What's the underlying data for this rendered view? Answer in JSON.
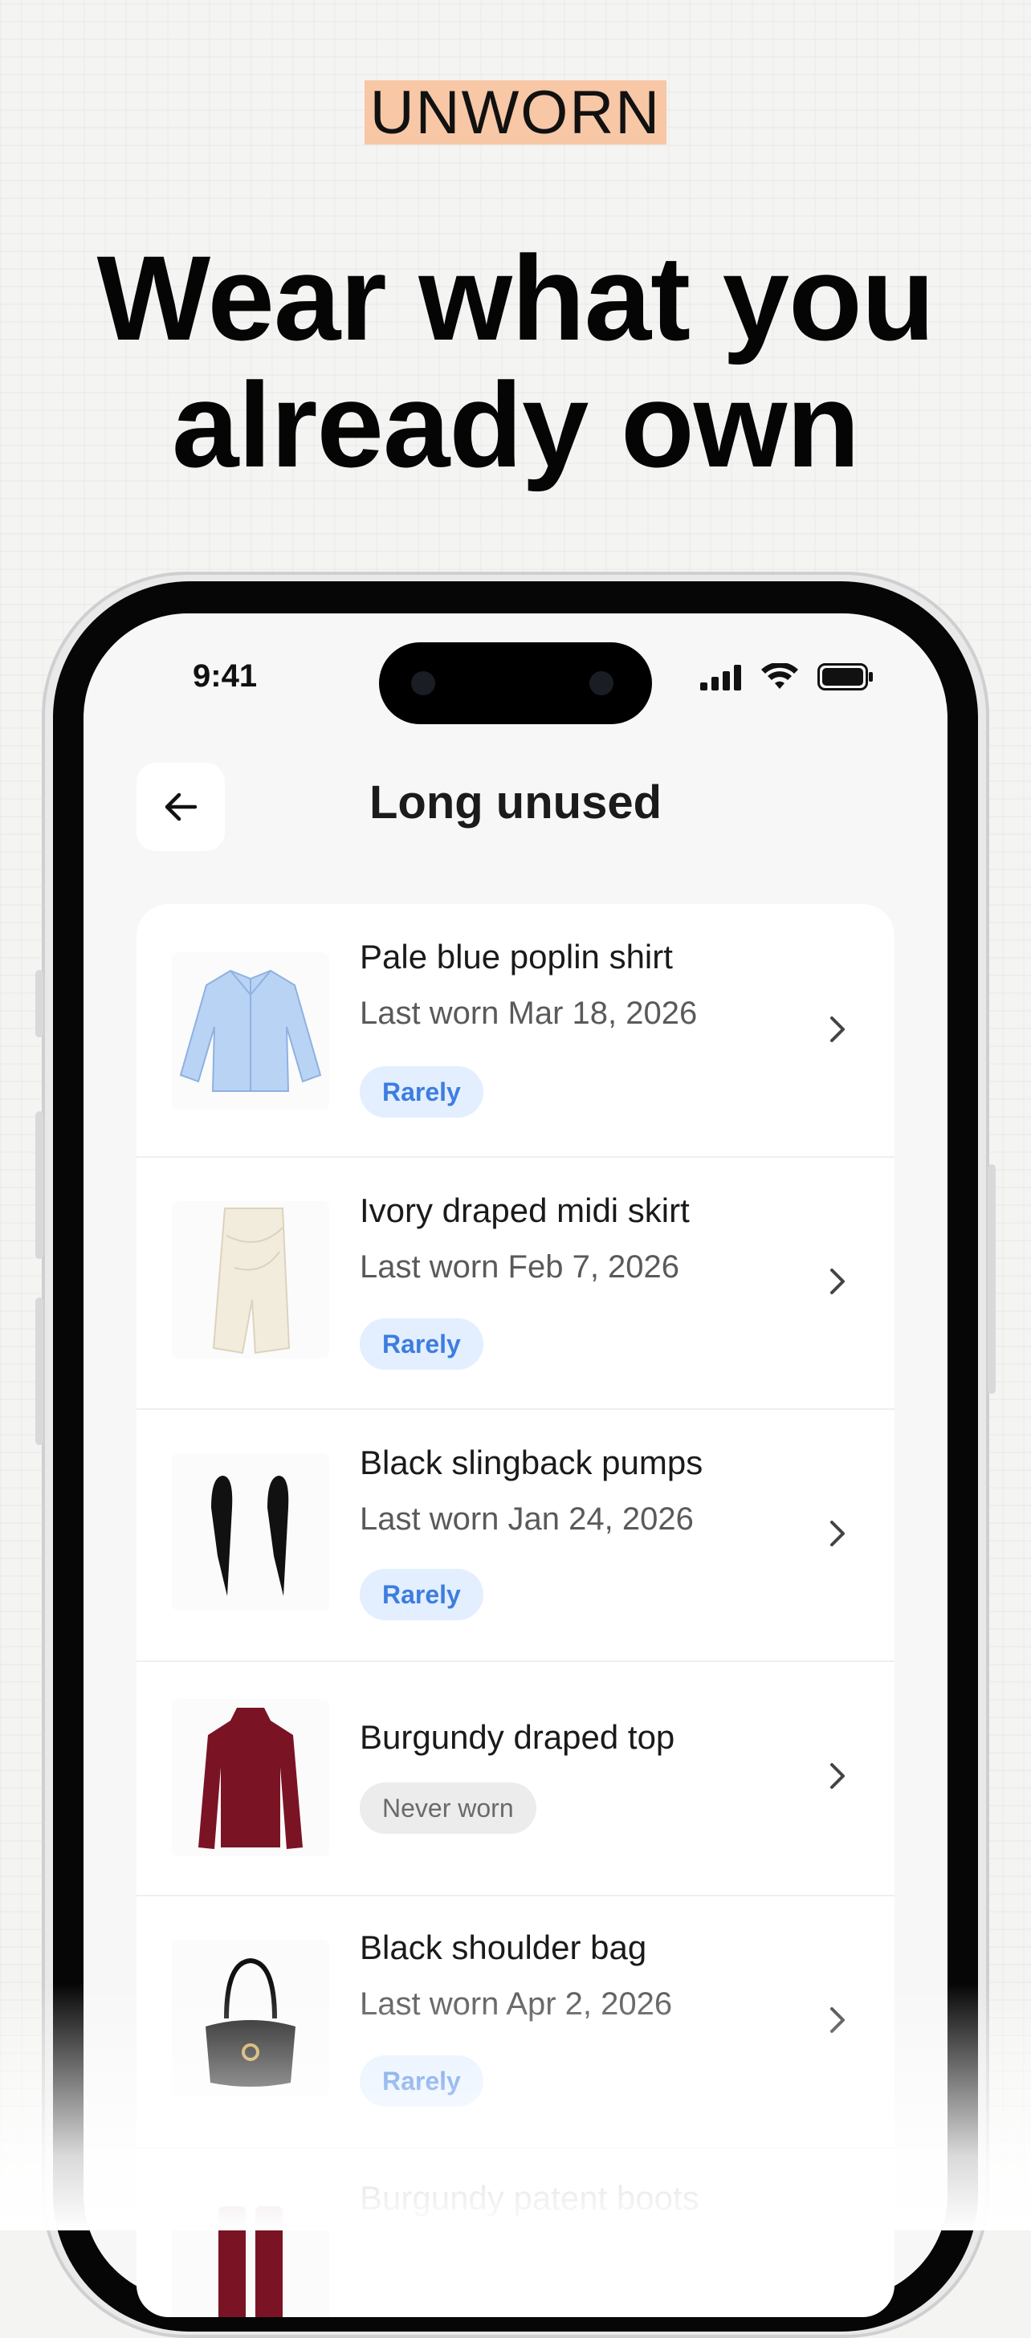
{
  "brand": {
    "tag": "UNWORN"
  },
  "headline": {
    "line1": "Wear what you",
    "line2": "already own"
  },
  "status_bar": {
    "time": "9:41"
  },
  "header": {
    "title": "Long unused"
  },
  "items": [
    {
      "name": "Pale blue poplin shirt",
      "last_worn": "Last worn Mar 18, 2026",
      "badge": "Rarely"
    },
    {
      "name": "Ivory draped midi skirt",
      "last_worn": "Last worn Feb 7, 2026",
      "badge": "Rarely"
    },
    {
      "name": "Black slingback pumps",
      "last_worn": "Last worn Jan 24, 2026",
      "badge": "Rarely"
    },
    {
      "name": "Burgundy draped top",
      "badge": "Never worn"
    },
    {
      "name": "Black shoulder bag",
      "last_worn": "Last worn Apr 2, 2026",
      "badge": "Rarely"
    },
    {
      "name": "Burgundy patent boots"
    }
  ],
  "colors": {
    "brand_tag_bg": "#f7c7a6",
    "rarely_pill_bg": "#e3efff",
    "rarely_pill_text": "#3d7de0",
    "never_pill_bg": "#ececec"
  }
}
